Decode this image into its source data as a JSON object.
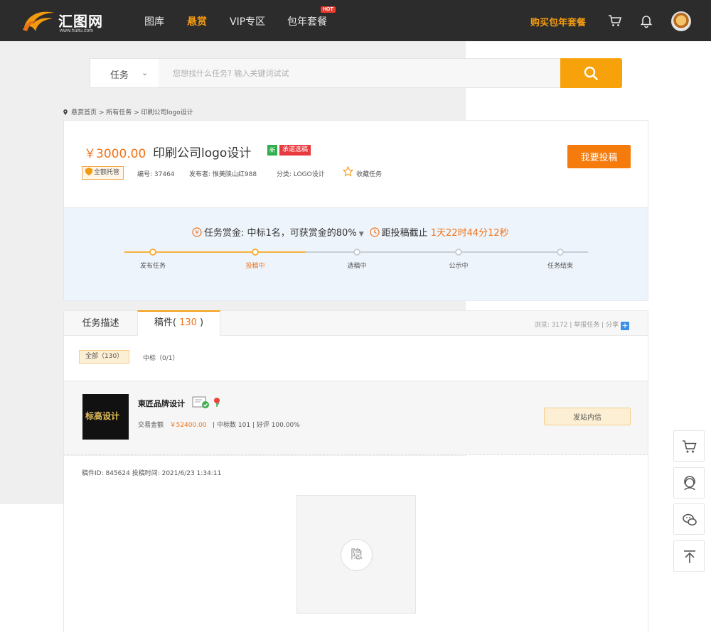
{
  "brand": {
    "name": "汇图网",
    "domain": "www.huitu.com"
  },
  "nav": {
    "items": [
      {
        "label": "图库",
        "active": false
      },
      {
        "label": "悬赏",
        "active": true
      },
      {
        "label": "VIP专区",
        "active": false
      },
      {
        "label": "包年套餐",
        "active": false
      }
    ],
    "hot_badge": "HOT",
    "buy_link": "购买包年套餐",
    "icons": [
      "cart-icon",
      "bell-icon",
      "avatar"
    ]
  },
  "search": {
    "category": "任务",
    "placeholder": "您想找什么任务? 输入关键词试试"
  },
  "breadcrumb": "悬赏首页 > 所有任务 > 印刷公司logo设计",
  "task": {
    "price": "￥3000.00",
    "title": "印刷公司logo设计",
    "tag_new": "新",
    "tag_promise": "承诺选稿",
    "trust_badge": "全额托管",
    "id_text": "编号:  37464",
    "publisher_text": "发布者:  惟美陕山红988",
    "category_text": "分类:  LOGO设计",
    "favorite": "收藏任务",
    "submit_button": "我要投稿"
  },
  "progress": {
    "reward_text": "任务赏金:  中标1名，可获赏金的80%",
    "deadline_label": "距投稿截止",
    "countdown": "1天22时44分12秒",
    "steps": [
      "发布任务",
      "投稿中",
      "选稿中",
      "公示中",
      "任务结束"
    ],
    "current_step": 1
  },
  "tabs": {
    "description": "任务描述",
    "manuscripts_prefix": "稿件( ",
    "manuscripts_count": "130",
    "manuscripts_suffix": " )",
    "stats": "浏览:  3172  |  举报任务  |  分享"
  },
  "filters": {
    "all": "全部（130）",
    "winning": "中标（0/1）"
  },
  "designer": {
    "logo_text": "标高设计",
    "name": "東匠品牌设计",
    "amount_label": "交易金额",
    "amount": "￥52400.00",
    "stats_rest": "|  中标数 101  |  好评 100.00%",
    "message_button": "发站内信"
  },
  "submission": {
    "meta": "稿件ID:  845624    投稿时间:  2021/6/23 1:34:11",
    "hidden_label": "隐"
  },
  "colors": {
    "accent": "#f39b0f",
    "price": "#f07319",
    "topbar": "#2c2c2c",
    "progress_bg": "#eef4fb"
  }
}
